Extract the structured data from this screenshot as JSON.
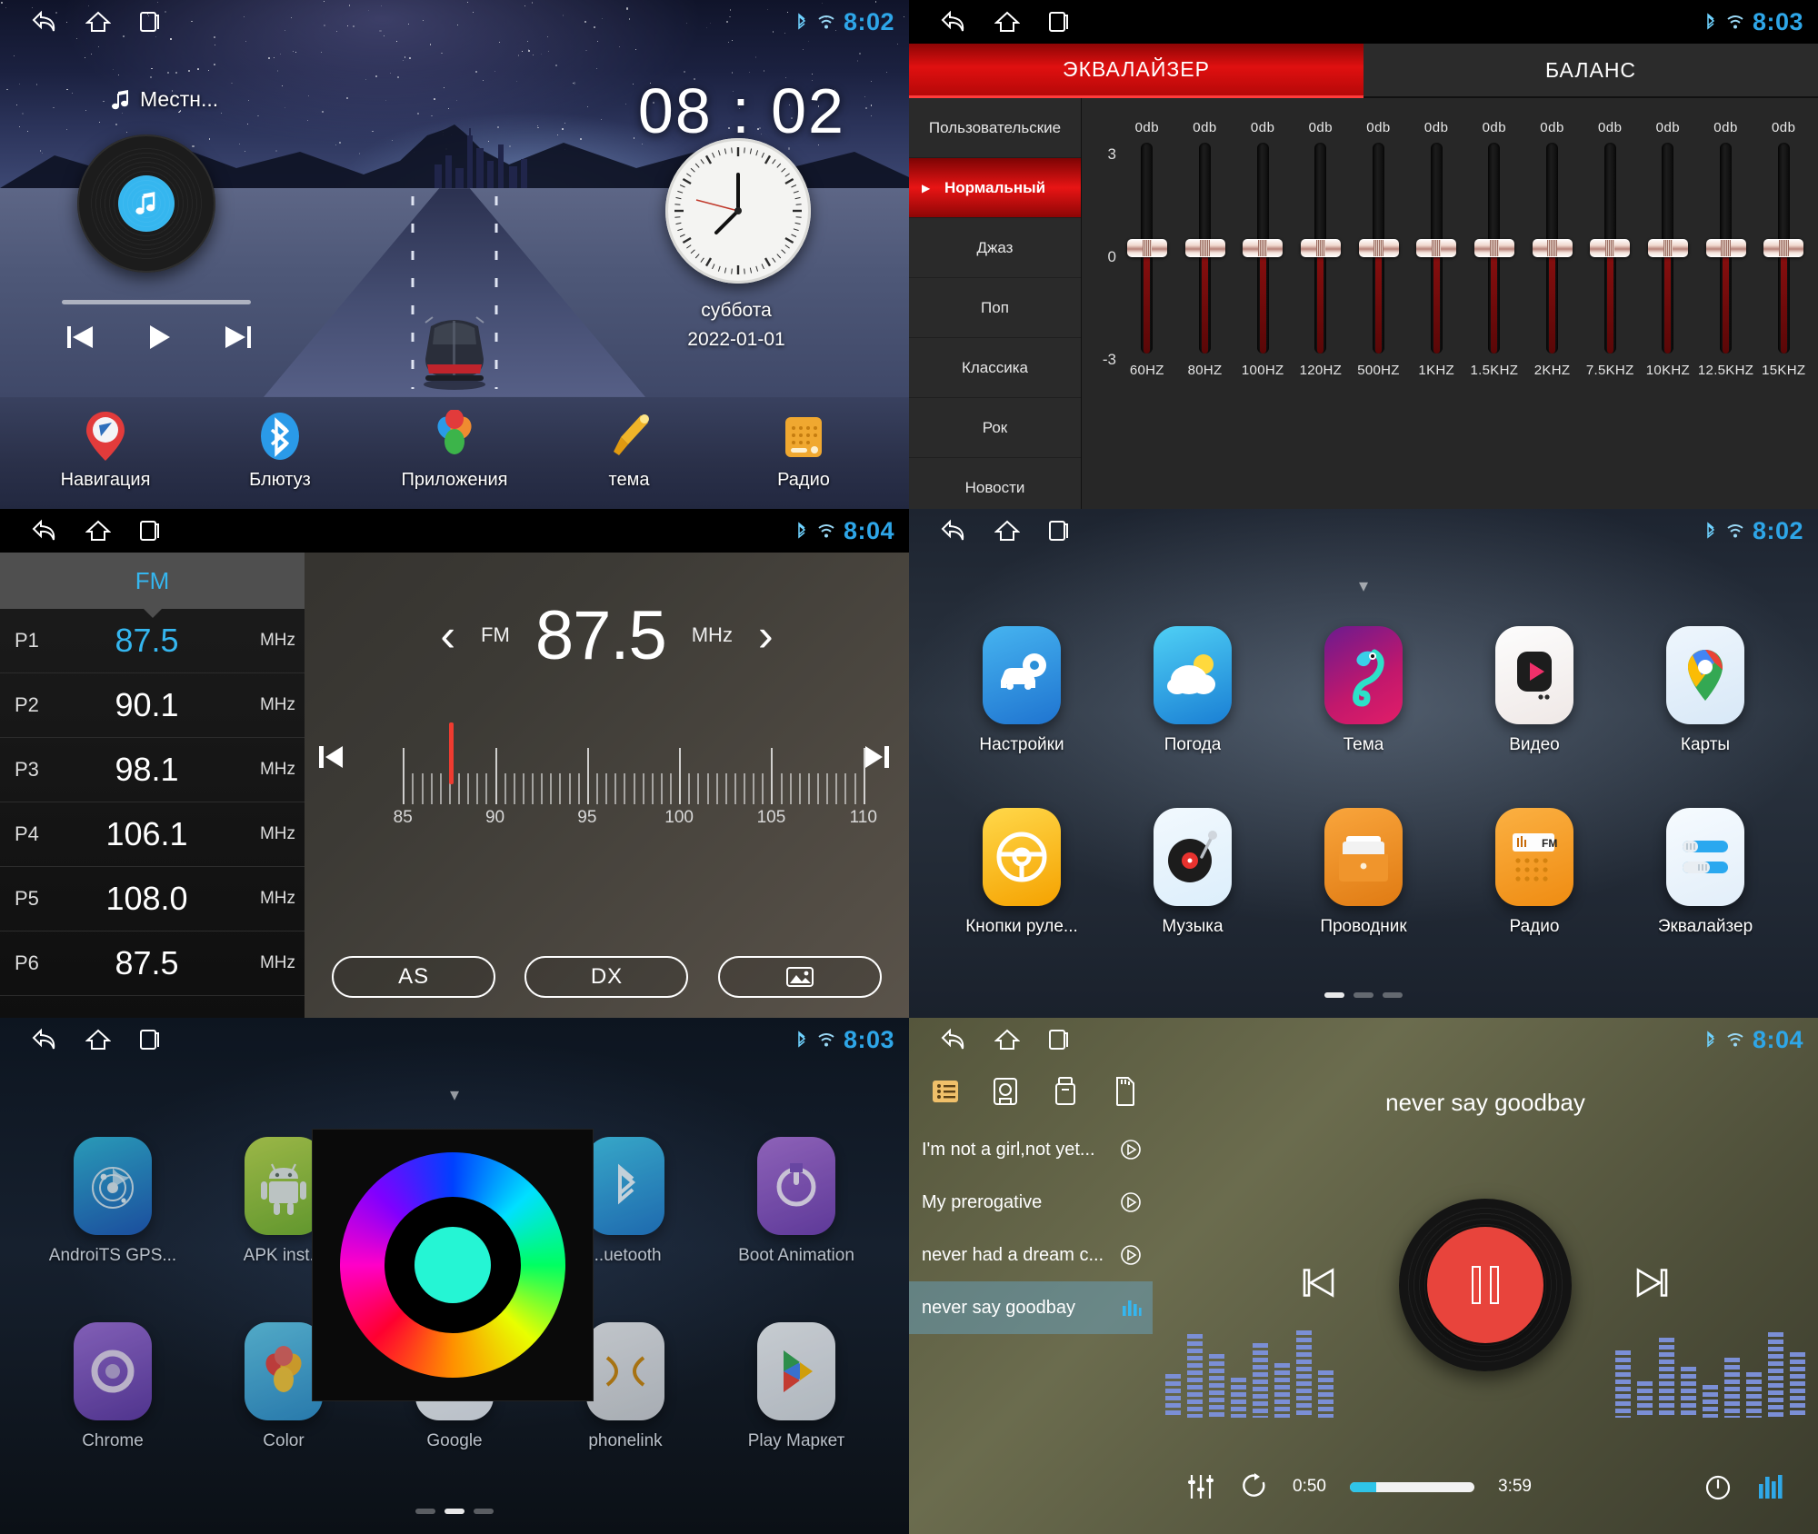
{
  "panels": {
    "home": {
      "status": {
        "time": "8:02"
      },
      "music_chip": "Местн...",
      "clock_digital": "08 : 02",
      "clock_day": "суббота",
      "clock_date": "2022-01-01",
      "dock": [
        {
          "label": "Навигация",
          "icon": "navigation-pin-icon"
        },
        {
          "label": "Блютуз",
          "icon": "bluetooth-icon"
        },
        {
          "label": "Приложения",
          "icon": "apps-flower-icon"
        },
        {
          "label": "тема",
          "icon": "paintbrush-icon"
        },
        {
          "label": "Радио",
          "icon": "radio-icon"
        }
      ]
    },
    "equalizer": {
      "status": {
        "time": "8:03"
      },
      "tabs": [
        {
          "label": "ЭКВАЛАЙЗЕР",
          "active": true
        },
        {
          "label": "БАЛАНС",
          "active": false
        }
      ],
      "presets": [
        {
          "label": "Пользовательские",
          "active": false
        },
        {
          "label": "Нормальный",
          "active": true
        },
        {
          "label": "Джаз",
          "active": false
        },
        {
          "label": "Поп",
          "active": false
        },
        {
          "label": "Классика",
          "active": false
        },
        {
          "label": "Рок",
          "active": false
        },
        {
          "label": "Новости",
          "active": false
        }
      ],
      "scale": {
        "top": "3",
        "mid": "0",
        "bottom": "-3"
      },
      "accent": "#e81414"
    },
    "fm": {
      "status": {
        "time": "8:04"
      },
      "band_label": "FM",
      "current": {
        "band": "FM",
        "freq": "87.5",
        "unit": "MHz"
      },
      "presets": [
        {
          "no": "P1",
          "freq": "87.5",
          "unit": "MHz",
          "active": true
        },
        {
          "no": "P2",
          "freq": "90.1",
          "unit": "MHz",
          "active": false
        },
        {
          "no": "P3",
          "freq": "98.1",
          "unit": "MHz",
          "active": false
        },
        {
          "no": "P4",
          "freq": "106.1",
          "unit": "MHz",
          "active": false
        },
        {
          "no": "P5",
          "freq": "108.0",
          "unit": "MHz",
          "active": false
        },
        {
          "no": "P6",
          "freq": "87.5",
          "unit": "MHz",
          "active": false
        }
      ],
      "scale_labels": [
        "85",
        "90",
        "95",
        "100",
        "105",
        "110"
      ],
      "buttons": [
        {
          "label": "AS",
          "name": "auto-store-button"
        },
        {
          "label": "DX",
          "name": "dx-local-button"
        },
        {
          "label": "",
          "name": "image-button"
        }
      ]
    },
    "apps_main": {
      "status": {
        "time": "8:02"
      },
      "apps": [
        {
          "label": "Настройки",
          "icon": "car-settings-icon"
        },
        {
          "label": "Погода",
          "icon": "weather-cloud-sun-icon"
        },
        {
          "label": "Тема",
          "icon": "chameleon-theme-icon"
        },
        {
          "label": "Видео",
          "icon": "video-play-icon"
        },
        {
          "label": "Карты",
          "icon": "google-maps-pin-icon"
        },
        {
          "label": "Кнопки руле...",
          "icon": "steering-wheel-icon"
        },
        {
          "label": "Музыка",
          "icon": "vinyl-music-icon"
        },
        {
          "label": "Проводник",
          "icon": "file-explorer-icon"
        },
        {
          "label": "Радио",
          "icon": "fm-radio-icon"
        },
        {
          "label": "Эквалайзер",
          "icon": "equalizer-sliders-icon"
        }
      ],
      "page_dots": 3,
      "active_dot": 0
    },
    "apps_second": {
      "status": {
        "time": "8:03"
      },
      "apps": [
        {
          "label": "AndroiTS GPS...",
          "icon": "gps-radar-icon"
        },
        {
          "label": "APK inst...",
          "icon": "android-robot-icon"
        },
        {
          "label": "",
          "icon": "generic-app-icon"
        },
        {
          "label": "...uetooth",
          "icon": "bluetooth-app-icon"
        },
        {
          "label": "Boot Animation",
          "icon": "power-boot-icon"
        },
        {
          "label": "Chrome",
          "icon": "chrome-icon"
        },
        {
          "label": "Color",
          "icon": "color-palette-icon"
        },
        {
          "label": "Google",
          "icon": "google-icon"
        },
        {
          "label": "phonelink",
          "icon": "phonelink-icon"
        },
        {
          "label": "Play Маркет",
          "icon": "play-store-icon"
        }
      ],
      "page_dots": 3,
      "active_dot": 1,
      "color_picker": {
        "name": "color-wheel-overlay",
        "selected_color": "#25f5d4"
      }
    },
    "music": {
      "status": {
        "time": "8:04"
      },
      "sources": [
        {
          "name": "playlist-icon",
          "active": true
        },
        {
          "name": "disk-icon",
          "active": false
        },
        {
          "name": "usb-icon",
          "active": false
        },
        {
          "name": "sdcard-icon",
          "active": false
        }
      ],
      "tracks": [
        {
          "title": "I'm not a girl,not yet...",
          "active": false
        },
        {
          "title": "My prerogative",
          "active": false
        },
        {
          "title": "never had a dream c...",
          "active": false
        },
        {
          "title": "never say goodbay",
          "active": true
        }
      ],
      "now_playing": "never say goodbay",
      "elapsed": "0:50",
      "duration": "3:59",
      "progress_percent": 21,
      "controls": [
        {
          "name": "equalizer-settings-icon"
        },
        {
          "name": "repeat-icon"
        },
        {
          "name": "timer-icon"
        },
        {
          "name": "visualizer-icon"
        }
      ],
      "accent": "#e8443c"
    }
  }
}
